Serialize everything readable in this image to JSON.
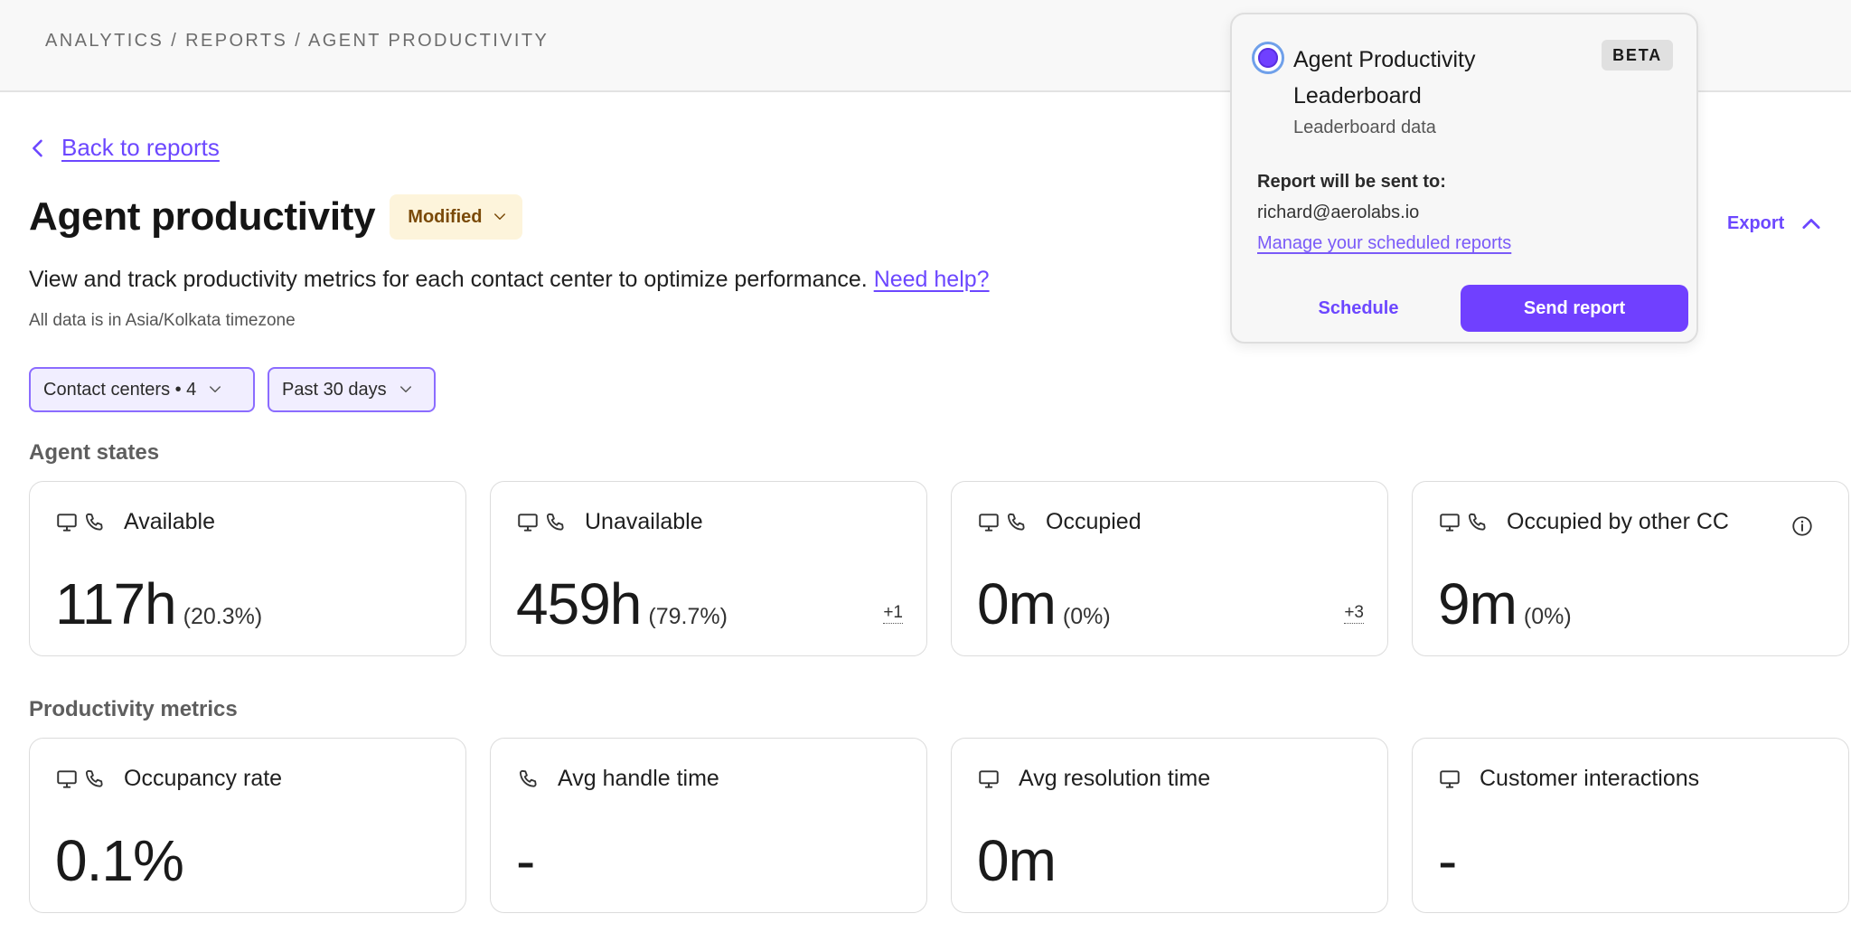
{
  "breadcrumb": "ANALYTICS / REPORTS / AGENT PRODUCTIVITY",
  "back_link": "Back to reports",
  "page": {
    "title": "Agent productivity",
    "status_badge": "Modified",
    "description": "View and track productivity metrics for each contact center to optimize performance.",
    "help_link": "Need help?",
    "timezone_note": "All data is in Asia/Kolkata timezone"
  },
  "filters": {
    "contact_centers": "Contact centers • 4",
    "date_range": "Past 30 days"
  },
  "agent_states": {
    "title": "Agent states",
    "cards": [
      {
        "label": "Available",
        "value": "117h",
        "percent": "(20.3%)"
      },
      {
        "label": "Unavailable",
        "value": "459h",
        "percent": "(79.7%)",
        "extra": "+1"
      },
      {
        "label": "Occupied",
        "value": "0m",
        "percent": "(0%)",
        "extra": "+3"
      },
      {
        "label": "Occupied by other CC",
        "value": "9m",
        "percent": "(0%)"
      }
    ]
  },
  "productivity_metrics": {
    "title": "Productivity metrics",
    "cards": [
      {
        "label": "Occupancy rate",
        "value": "0.1%"
      },
      {
        "label": "Avg handle time",
        "value": "-"
      },
      {
        "label": "Avg resolution time",
        "value": "0m"
      },
      {
        "label": "Customer interactions",
        "value": "-"
      }
    ]
  },
  "export_label": "Export",
  "popover": {
    "title": "Agent Productivity Leaderboard",
    "subtitle": "Leaderboard data",
    "badge": "BETA",
    "sent_to_label": "Report will be sent to:",
    "email": "richard@aerolabs.io",
    "manage_link": "Manage your scheduled reports",
    "schedule_button": "Schedule",
    "send_button": "Send report"
  },
  "colors": {
    "accent": "#6c47ff",
    "badge_bg": "#fdf4db",
    "badge_text": "#7a4a08",
    "filter_bg": "#f1eeff"
  }
}
